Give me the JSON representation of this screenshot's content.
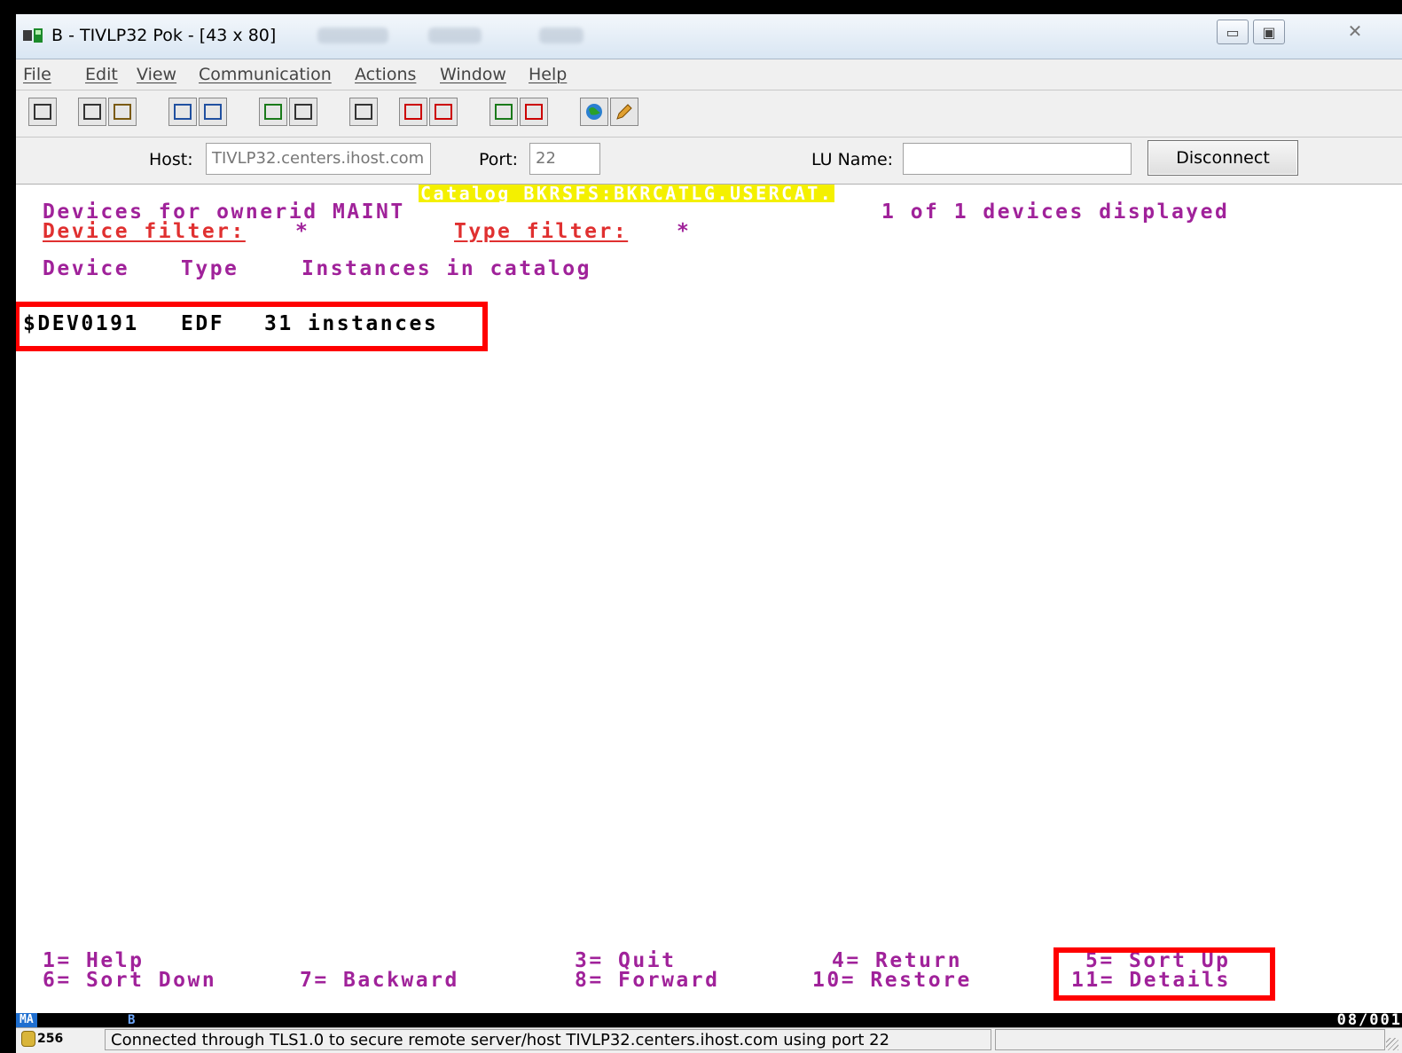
{
  "window": {
    "title": "B - TIVLP32 Pok - [43 x 80]",
    "minimize_glyph": "▭",
    "maximize_glyph": "▣",
    "close_glyph": "✕"
  },
  "menu": [
    "File",
    "Edit",
    "View",
    "Communication",
    "Actions",
    "Window",
    "Help"
  ],
  "toolbar_icons": [
    "print-screen-icon",
    "copy-icon",
    "paste-icon",
    "send-file-icon",
    "receive-file-icon",
    "display-icon",
    "keypad-icon",
    "macro-icon",
    "record-macro-icon",
    "play-macro-icon",
    "start-icon",
    "stop-icon",
    "globe-icon",
    "edit-icon"
  ],
  "hostbar": {
    "host_label": "Host:",
    "host_value": "TIVLP32.centers.ihost.com",
    "port_label": "Port:",
    "port_value": "22",
    "lu_label": "LU Name:",
    "lu_value": "",
    "disconnect_label": "Disconnect"
  },
  "screen": {
    "catalog_banner": "Catalog BKRSFS:BKRCATLG.USERCAT.",
    "heading": "Devices for ownerid MAINT",
    "count": "1 of 1 devices displayed",
    "device_filter_label": "Device filter:",
    "device_filter_value": "*",
    "type_filter_label": "Type filter:",
    "type_filter_value": "*",
    "columns": [
      "Device",
      "Type",
      "Instances in catalog"
    ],
    "rows": [
      {
        "device": "$DEV0191",
        "type": "EDF",
        "instances": "31 instances"
      }
    ],
    "pf_keys": {
      "pf1": "1= Help",
      "pf3": "3= Quit",
      "pf4": "4= Return",
      "pf5": "5= Sort Up",
      "pf6": "6= Sort Down",
      "pf7": "7= Backward",
      "pf8": "8= Forward",
      "pf10": "10= Restore",
      "pf11": "11= Details"
    }
  },
  "oia": {
    "indicator": "MA",
    "session": "B",
    "cursor_position": "08/001"
  },
  "statusbar": {
    "key_length": "256",
    "message": "Connected through TLS1.0 to secure remote server/host TIVLP32.centers.ihost.com using port 22"
  },
  "colors": {
    "field_purple": "#a0229a",
    "field_red": "#e03030",
    "banner_yellow": "#f4f000",
    "highlight_box": "#ff0000"
  }
}
